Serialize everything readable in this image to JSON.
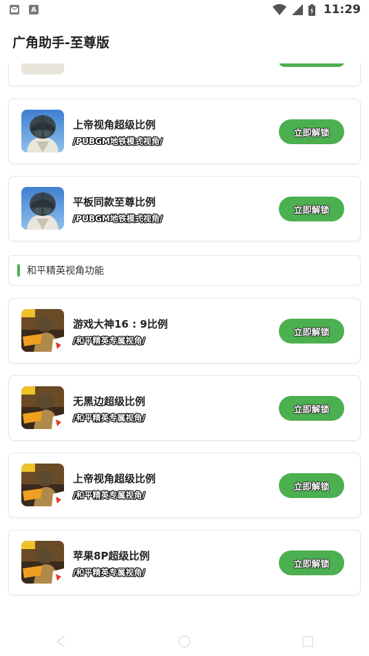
{
  "status_bar": {
    "time": "11:29",
    "notif_icons": [
      "mail-icon",
      "a-icon"
    ]
  },
  "app": {
    "title": "广角助手-至尊版"
  },
  "pubg_cards": [
    {
      "title": "上帝视角超级比例",
      "subtitle": "/PUBGM地铁模式视角/",
      "button": "立即解锁"
    },
    {
      "title": "平板同款至尊比例",
      "subtitle": "/PUBGM地铁模式视角/",
      "button": "立即解锁"
    }
  ],
  "section": {
    "title": "和平精英视角功能",
    "accent_color": "#4caf50"
  },
  "peace_cards": [
    {
      "title": "游戏大神16 : 9比例",
      "subtitle": "/和平精英专属视角/",
      "button": "立即解锁"
    },
    {
      "title": "无黑边超级比例",
      "subtitle": "/和平精英专属视角/",
      "button": "立即解锁"
    },
    {
      "title": "上帝视角超级比例",
      "subtitle": "/和平精英专属视角/",
      "button": "立即解锁"
    },
    {
      "title": "苹果8P超级比例",
      "subtitle": "/和平精英专属视角/",
      "button": "立即解锁"
    }
  ],
  "colors": {
    "button": "#4caf50",
    "card_border": "#e6e6e6"
  }
}
